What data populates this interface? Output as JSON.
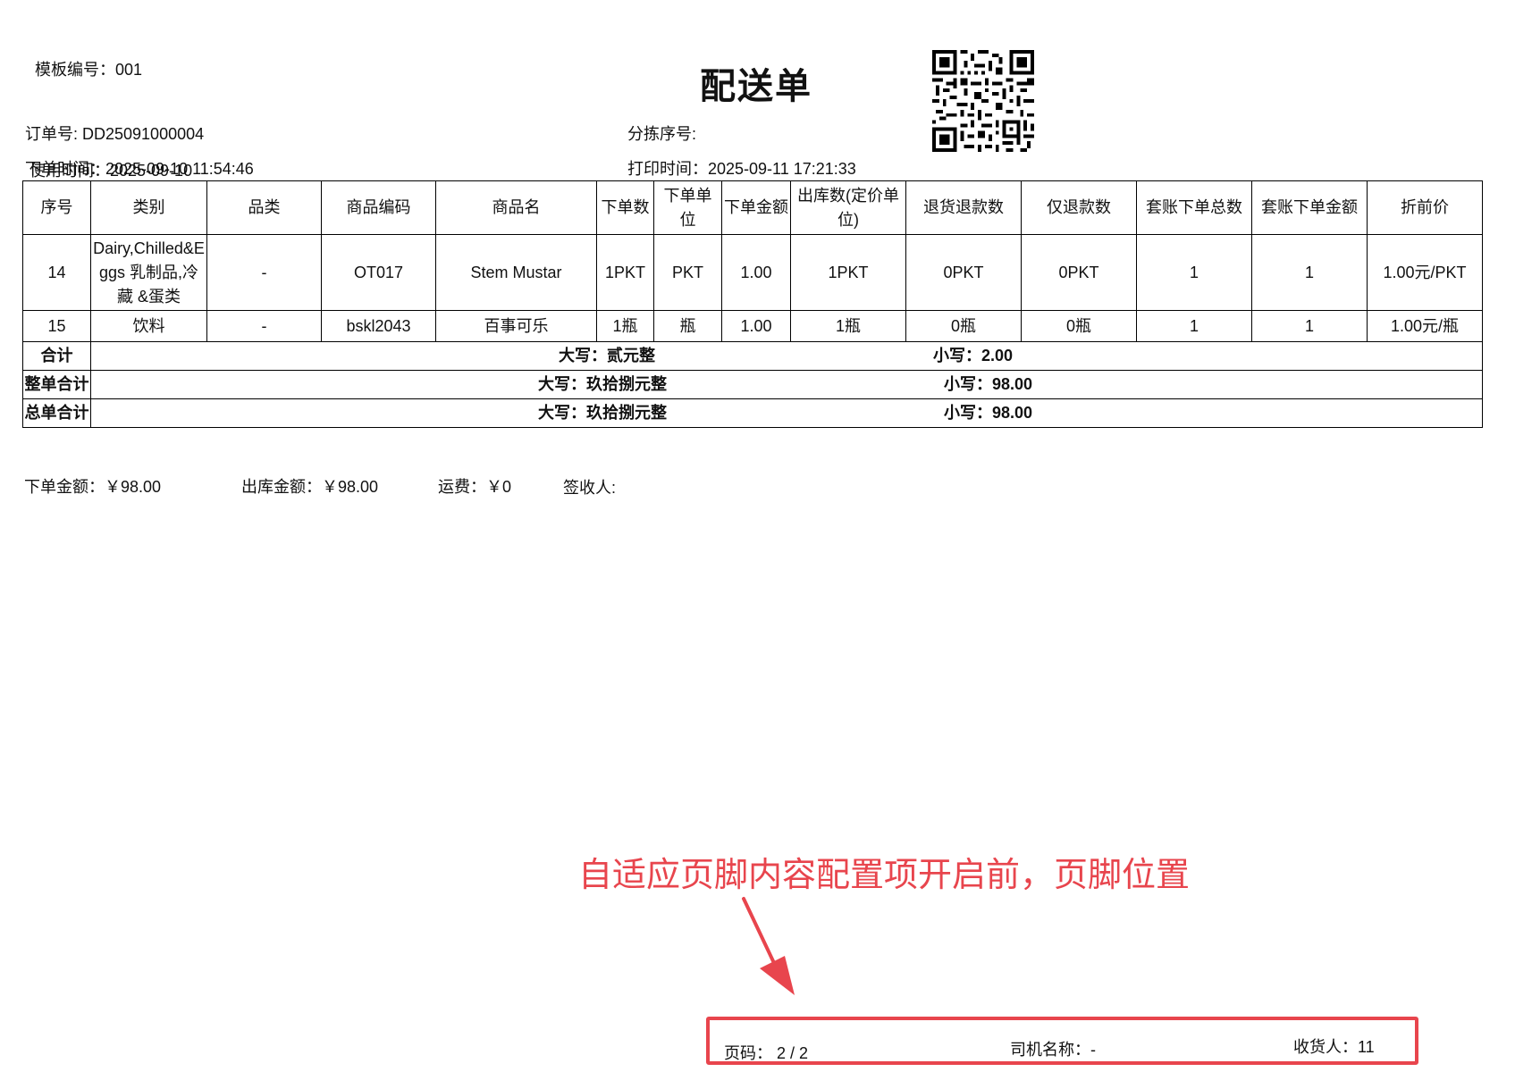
{
  "header": {
    "template_no": "模板编号：001",
    "title": "配送单",
    "order_no": "订单号: DD25091000004",
    "sort_no": "分拣序号:",
    "order_time_overlap_a": "下单时间：2025-09-10 11:54:46",
    "order_time_overlap_b": "使用时间：2025-09-10",
    "print_time": "打印时间：2025-09-11 17:21:33"
  },
  "table": {
    "headers": [
      "序号",
      "类别",
      "品类",
      "商品编码",
      "商品名",
      "下单数",
      "下单单位",
      "下单金额",
      "出库数(定价单位)",
      "退货退款数",
      "仅退款数",
      "套账下单总数",
      "套账下单金额",
      "折前价"
    ],
    "rows": [
      [
        "14",
        "Dairy,Chilled&Eggs 乳制品,冷藏 &蛋类",
        "-",
        "OT017",
        "Stem Mustar",
        "1PKT",
        "PKT",
        "1.00",
        "1PKT",
        "0PKT",
        "0PKT",
        "1",
        "1",
        "1.00元/PKT"
      ],
      [
        "15",
        "饮料",
        "-",
        "bskl2043",
        "百事可乐",
        "1瓶",
        "瓶",
        "1.00",
        "1瓶",
        "0瓶",
        "0瓶",
        "1",
        "1",
        "1.00元/瓶"
      ]
    ],
    "totals": [
      {
        "label": "合计",
        "upper": "大写：贰元整",
        "lower": "小写：2.00"
      },
      {
        "label": "整单合计",
        "upper": "大写：玖拾捌元整",
        "lower": "小写：98.00"
      },
      {
        "label": "总单合计",
        "upper": "大写：玖拾捌元整",
        "lower": "小写：98.00"
      }
    ]
  },
  "summary": {
    "order_amount": "下单金额：￥98.00",
    "out_amount": "出库金额：￥98.00",
    "freight": "运费：￥0",
    "signer": "签收人:"
  },
  "annotation": {
    "text": "自适应页脚内容配置项开启前，页脚位置",
    "color": "#e8454d"
  },
  "footer": {
    "page": "页码： 2 / 2",
    "driver": "司机名称：-",
    "receiver": "收货人：11"
  }
}
